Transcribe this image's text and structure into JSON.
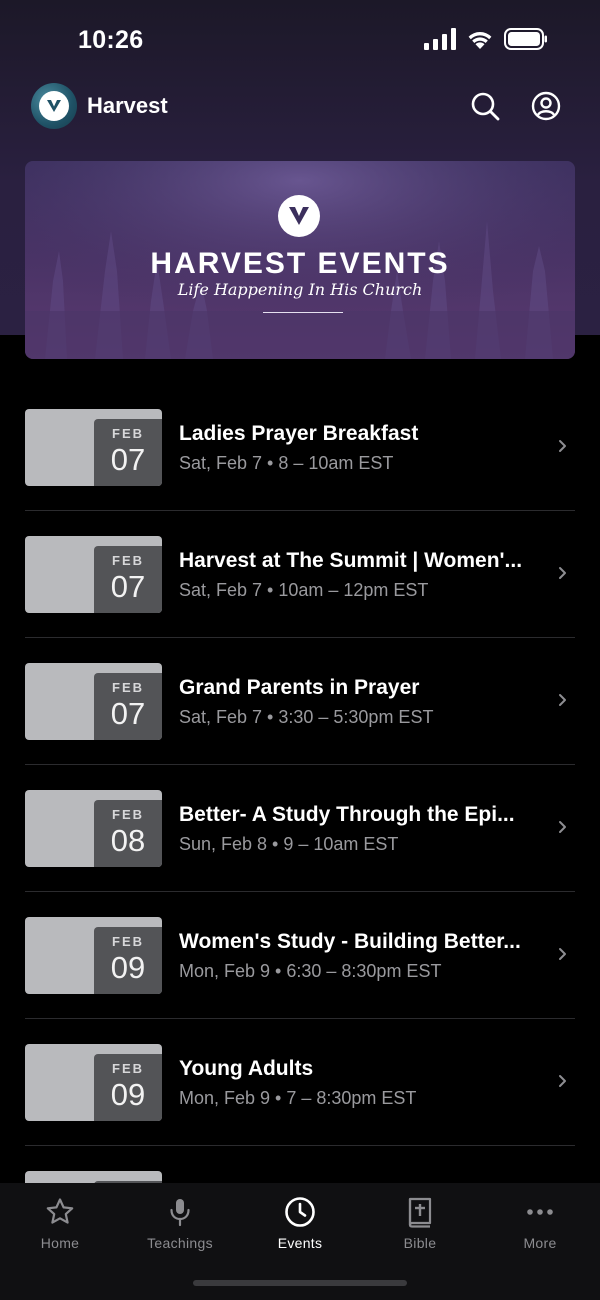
{
  "status_bar": {
    "time": "10:26"
  },
  "header": {
    "app_name": "Harvest"
  },
  "banner": {
    "title": "HARVEST EVENTS",
    "subtitle": "Life Happening In His Church"
  },
  "events": [
    {
      "month": "FEB",
      "day": "07",
      "title": "Ladies Prayer Breakfast",
      "meta": "Sat, Feb 7 • 8 – 10am EST"
    },
    {
      "month": "FEB",
      "day": "07",
      "title": "Harvest at The Summit | Women'...",
      "meta": "Sat, Feb 7 • 10am – 12pm EST"
    },
    {
      "month": "FEB",
      "day": "07",
      "title": "Grand Parents in Prayer",
      "meta": "Sat, Feb 7 • 3:30 – 5:30pm EST"
    },
    {
      "month": "FEB",
      "day": "08",
      "title": "Better- A Study Through the Epi...",
      "meta": "Sun, Feb 8 • 9 – 10am EST"
    },
    {
      "month": "FEB",
      "day": "09",
      "title": "Women's Study - Building Better...",
      "meta": "Mon, Feb 9 • 6:30 – 8:30pm EST"
    },
    {
      "month": "FEB",
      "day": "09",
      "title": "Young Adults",
      "meta": "Mon, Feb 9 • 7 – 8:30pm EST"
    }
  ],
  "tabs": [
    {
      "label": "Home",
      "icon": "star-icon"
    },
    {
      "label": "Teachings",
      "icon": "microphone-icon"
    },
    {
      "label": "Events",
      "icon": "clock-icon",
      "active": true
    },
    {
      "label": "Bible",
      "icon": "bible-icon"
    },
    {
      "label": "More",
      "icon": "more-icon"
    }
  ]
}
